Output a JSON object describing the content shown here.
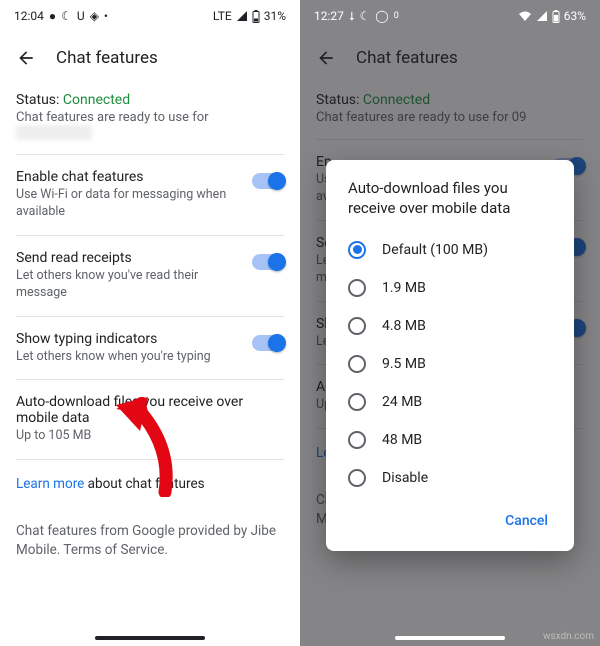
{
  "left": {
    "status_time": "12:04",
    "status_network": "LTE",
    "status_battery": "31%",
    "header_title": "Chat features",
    "status_label": "Status: ",
    "status_value": "Connected",
    "status_sub_prefix": "Chat features are ready to use for ",
    "status_sub_hidden": "#########",
    "settings": {
      "s0": {
        "title": "Enable chat features",
        "sub": "Use Wi-Fi or data for messaging when available"
      },
      "s1": {
        "title": "Send read receipts",
        "sub": "Let others know you've read their message"
      },
      "s2": {
        "title": "Show typing indicators",
        "sub": "Let others know when you're typing"
      },
      "s3": {
        "title": "Auto-download files you receive over mobile data",
        "sub": "Up to 105 MB"
      }
    },
    "learn_link": "Learn more",
    "learn_rest": " about chat features",
    "footer": "Chat features from Google provided by Jibe Mobile. Terms of Service."
  },
  "right": {
    "status_time": "12:27",
    "status_battery": "63%",
    "header_title": "Chat features",
    "status_label": "Status: ",
    "status_value": "Connected",
    "status_sub_prefix": "Chat features are ready to use for 09",
    "dialog_title": "Auto-download files you receive over mobile data",
    "options": {
      "o0": "Default (100 MB)",
      "o1": "1.9 MB",
      "o2": "4.8 MB",
      "o3": "9.5 MB",
      "o4": "24 MB",
      "o5": "48 MB",
      "o6": "Disable"
    },
    "cancel": "Cancel"
  },
  "watermark": "wsxdn.com"
}
